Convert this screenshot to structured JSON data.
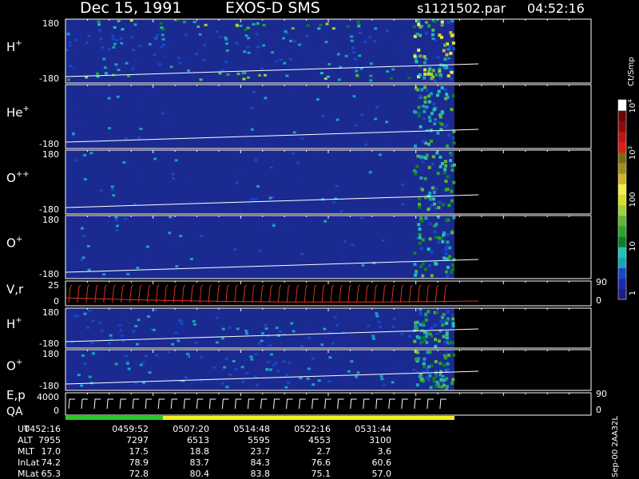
{
  "header": {
    "date": "Dec 15, 1991",
    "mission": "EXOS-D SMS",
    "file": "s1121502.par",
    "time": "04:52:16"
  },
  "colorbar": {
    "unit": "Ct/Smp",
    "ticks": [
      "1",
      "10",
      "100",
      "10",
      "10"
    ],
    "tick_powers": [
      "",
      "",
      "",
      "3",
      "4"
    ],
    "tick_values": [
      1,
      10,
      100,
      1000,
      10000
    ],
    "colors": [
      "#1b1e86",
      "#1a2aa8",
      "#1648c8",
      "#1aa0b8",
      "#22c0b8",
      "#0f7d22",
      "#2aa52a",
      "#64b43c",
      "#9ed23a",
      "#d8de28",
      "#f0f046",
      "#d2b228",
      "#a08c1e",
      "#7a6a14",
      "#dc1e14",
      "#be1414",
      "#8c0a0a",
      "#6a0505",
      "#ffffff"
    ]
  },
  "panels": [
    {
      "label": "H",
      "sup": "+",
      "ytop": "180",
      "ybot": "-180",
      "series": [
        {
          "name": "H+",
          "color": "#ffffff"
        }
      ]
    },
    {
      "label": "He",
      "sup": "+",
      "ytop": "",
      "ybot": "-180",
      "series": [
        {
          "name": "He+",
          "color": "#ffffff"
        }
      ]
    },
    {
      "label": "O",
      "sup": "++",
      "ytop": "180",
      "ybot": "-180",
      "series": [
        {
          "name": "O++",
          "color": "#ffffff"
        }
      ]
    },
    {
      "label": "O",
      "sup": "+",
      "ytop": "180",
      "ybot": "-180",
      "series": [
        {
          "name": "O+",
          "color": "#ffffff"
        }
      ]
    },
    {
      "label": "V,r",
      "sup": "",
      "ytop": "25",
      "ybot": "0",
      "rtop": "90",
      "rbot": "0"
    },
    {
      "label": "H",
      "sup": "+",
      "ytop": "180",
      "ybot": "-180"
    },
    {
      "label": "O",
      "sup": "+",
      "ytop": "180",
      "ybot": "-180"
    },
    {
      "label": "E,p",
      "label2": "QA",
      "sup": "",
      "ytop": "4000",
      "ybot": "0",
      "rtop": "90",
      "rbot": "0"
    }
  ],
  "ephemeris": {
    "labels": [
      "UT",
      "ALT",
      "MLT",
      "InLat",
      "MLat"
    ],
    "columns": [
      [
        "0452:16",
        "7955",
        "17.0",
        "74.2",
        "65.3"
      ],
      [
        "0459:52",
        "7297",
        "17.5",
        "78.9",
        "72.8"
      ],
      [
        "0507:20",
        "6513",
        "18.8",
        "83.7",
        "80.4"
      ],
      [
        "0514:48",
        "5595",
        "23.7",
        "84.3",
        "83.8"
      ],
      [
        "0522:16",
        "4553",
        "2.7",
        "76.6",
        "75.1"
      ],
      [
        "0531:44",
        "3100",
        "3.6",
        "60.6",
        "57.0"
      ]
    ]
  },
  "footer": {
    "tag": "Sep-00 2AA32L"
  },
  "chart_data": {
    "type": "heatmap",
    "title": "Dec 15, 1991   EXOS-D SMS",
    "xlabel": "UT",
    "x_ticks": [
      "0452:16",
      "0459:52",
      "0507:20",
      "0514:48",
      "0522:16",
      "0531:44"
    ],
    "data_end_fraction": 0.74,
    "colorbar": {
      "label": "Ct/Smp",
      "scale": "log",
      "range": [
        1,
        10000
      ]
    },
    "series": [
      {
        "name": "H+",
        "yrange": [
          -180,
          180
        ]
      },
      {
        "name": "He+",
        "yrange": [
          -180,
          180
        ]
      },
      {
        "name": "O++",
        "yrange": [
          -180,
          180
        ]
      },
      {
        "name": "O+",
        "yrange": [
          -180,
          180
        ]
      },
      {
        "name": "V,r",
        "yrange": [
          0,
          25
        ],
        "right_range": [
          0,
          90
        ]
      },
      {
        "name": "H+",
        "yrange": [
          -180,
          180
        ]
      },
      {
        "name": "O+",
        "yrange": [
          -180,
          180
        ]
      },
      {
        "name": "E,p",
        "yrange": [
          0,
          4000
        ],
        "right_range": [
          0,
          90
        ]
      }
    ]
  }
}
